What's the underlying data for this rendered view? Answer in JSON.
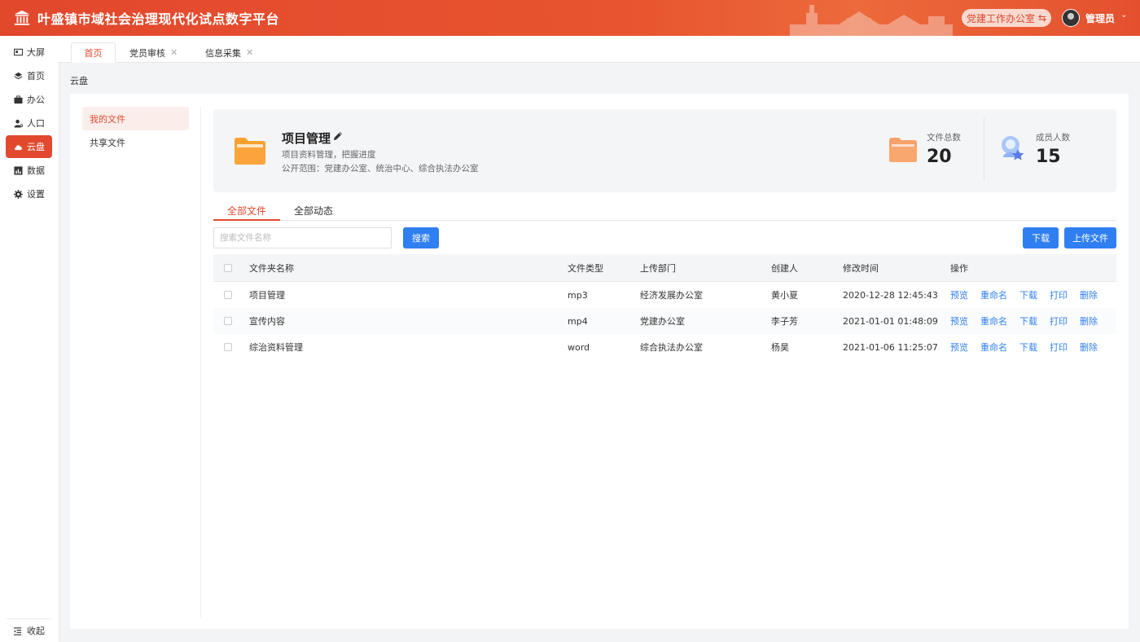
{
  "header": {
    "title": "叶盛镇市域社会治理现代化试点数字平台",
    "office": "党建工作办公室",
    "username": "管理员"
  },
  "sidebar": {
    "items": [
      {
        "label": "大屏",
        "icon": "screen-icon"
      },
      {
        "label": "首页",
        "icon": "layers-icon"
      },
      {
        "label": "办公",
        "icon": "briefcase-icon"
      },
      {
        "label": "人口",
        "icon": "person-icon"
      },
      {
        "label": "云盘",
        "icon": "cloud-icon",
        "active": true
      },
      {
        "label": "数据",
        "icon": "chart-icon"
      },
      {
        "label": "设置",
        "icon": "gear-icon"
      }
    ],
    "collapse": "收起"
  },
  "tabs": [
    {
      "label": "首页",
      "active": true
    },
    {
      "label": "党员审核"
    },
    {
      "label": "信息采集"
    }
  ],
  "breadcrumb": "云盘",
  "left_menu": [
    {
      "label": "我的文件",
      "active": true
    },
    {
      "label": "共享文件"
    }
  ],
  "project": {
    "name": "项目管理",
    "desc": "项目资料管理，把握进度",
    "scope": "公开范围：党建办公室、统治中心、综合执法办公室",
    "stats": [
      {
        "label": "文件总数",
        "value": "20"
      },
      {
        "label": "成员人数",
        "value": "15"
      }
    ]
  },
  "content_tabs": [
    "全部文件",
    "全部动态"
  ],
  "toolbar": {
    "search_placeholder": "搜索文件名称",
    "search_btn": "搜索",
    "download_btn": "下载",
    "upload_btn": "上传文件"
  },
  "table": {
    "columns": [
      "文件夹名称",
      "文件类型",
      "上传部门",
      "创建人",
      "修改时间",
      "操作"
    ],
    "rows": [
      {
        "name": "项目管理",
        "type": "mp3",
        "dept": "经济发展办公室",
        "creator": "黄小夏",
        "time": "2020-12-28 12:45:43"
      },
      {
        "name": "宣传内容",
        "type": "mp4",
        "dept": "党建办公室",
        "creator": "李子芳",
        "time": "2021-01-01 01:48:09"
      },
      {
        "name": "综治资料管理",
        "type": "word",
        "dept": "综合执法办公室",
        "creator": "杨昊",
        "time": "2021-01-06 11:25:07"
      }
    ],
    "actions": [
      "预览",
      "重命名",
      "下载",
      "打印",
      "删除"
    ]
  },
  "colors": {
    "brand": "#e14a2e",
    "primary_blue": "#2f7ff0"
  }
}
